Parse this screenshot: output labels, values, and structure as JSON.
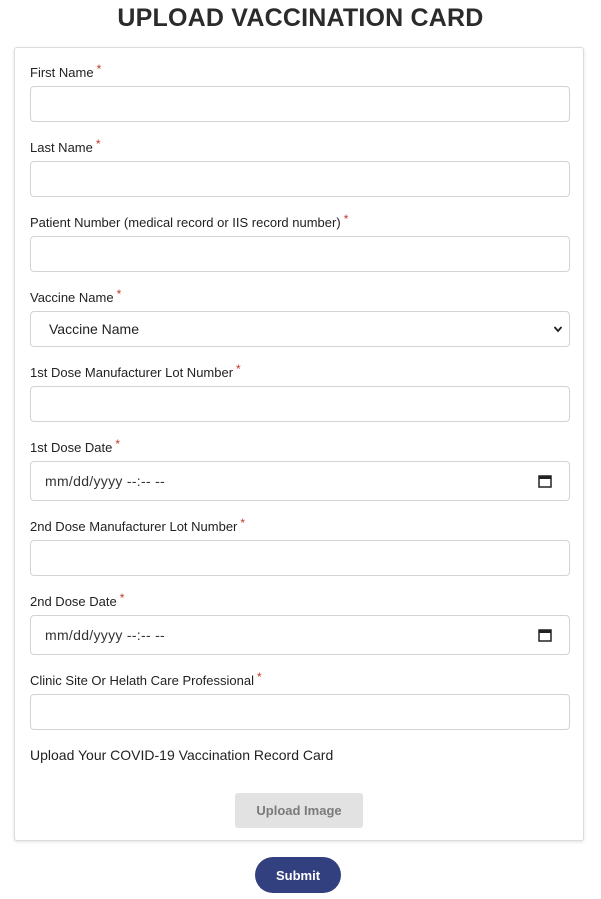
{
  "page": {
    "title": "UPLOAD VACCINATION CARD"
  },
  "form": {
    "required_mark": "*",
    "first_name": {
      "label": "First Name",
      "value": ""
    },
    "last_name": {
      "label": "Last Name",
      "value": ""
    },
    "patient_number": {
      "label": "Patient Number (medical record or IIS record number)",
      "value": ""
    },
    "vaccine_name": {
      "label": "Vaccine Name",
      "selected": "Vaccine Name"
    },
    "dose1_lot": {
      "label": "1st Dose Manufacturer Lot Number",
      "value": ""
    },
    "dose1_date": {
      "label": "1st Dose Date",
      "placeholder": "mm/dd/yyyy --:-- --"
    },
    "dose2_lot": {
      "label": "2nd Dose Manufacturer Lot Number",
      "value": ""
    },
    "dose2_date": {
      "label": "2nd Dose Date",
      "placeholder": "mm/dd/yyyy --:-- --"
    },
    "clinic": {
      "label": "Clinic Site Or Helath Care Professional",
      "value": ""
    },
    "upload_prompt": "Upload Your COVID-19 Vaccination Record Card",
    "upload_button": "Upload Image",
    "submit_button": "Submit"
  },
  "icons": {
    "select": "chevron-down-icon",
    "date": "calendar-icon"
  },
  "colors": {
    "required": "#c0392b",
    "submit_bg": "#33407f",
    "upload_bg": "#e2e2e2"
  }
}
